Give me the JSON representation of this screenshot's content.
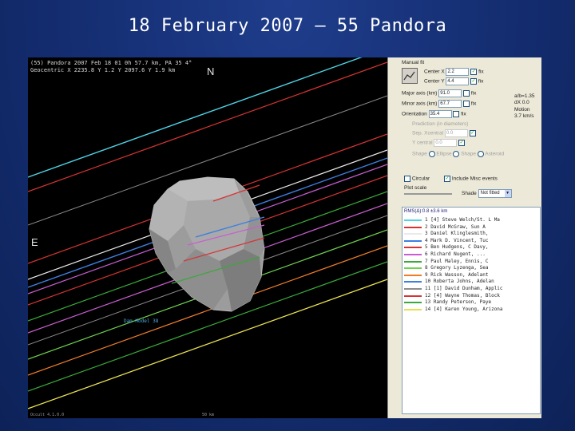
{
  "slide": {
    "title": "18 February 2007 – 55 Pandora"
  },
  "plot": {
    "header_line1": "(55) Pandora 2007 Feb 18  01 0h 57.7 km, PA 35 4°",
    "header_line2": "Geocentric X  2235.8 Y 1.2 Y 2097.6 Y 1.9 km",
    "compass_north": "N",
    "compass_east": "E",
    "model_label": "Dam Model 38",
    "status_left": "Occult 4.1.0.0",
    "status_mid": "50 km"
  },
  "panel": {
    "fit_title": "Manual fit",
    "center_x_label": "Center X",
    "center_x_value": "2.2",
    "center_y_label": "Center Y",
    "center_y_value": "4.4",
    "major_label": "Major axis (km)",
    "major_value": "91.0",
    "minor_label": "Minor axis (km)",
    "minor_value": "67.7",
    "orient_label": "Orientation",
    "orient_value": "35.4",
    "fix_label": "fix",
    "side_note1": "a/b=1.35",
    "side_note2": "dX 0.0",
    "motion_label": "Motion",
    "motion_value": "3.7 km/s",
    "predict_label": "Prediction (in diameters)",
    "pred_x_label": "Sep. Xcentral",
    "pred_x_value": "0.0",
    "pred_y_label": "Y central",
    "pred_y_value": "0.0",
    "shape_label": "Shape",
    "shape_opt1": "Ellipse",
    "shape_opt2": "Shape",
    "shape_opt3": "Asteroid",
    "circular_label": "Circular",
    "include_label": "Include Misc events",
    "plot_scale_label": "Plot scale",
    "shade_label": "Shade",
    "shade_value": "Not fitted",
    "rms_label": "RMS(Δ):0.8 ±3.6 km",
    "chords": [
      {
        "num": "1 [4]",
        "name": "Steve Welch/St. L Ma",
        "color": "#4fd3e6"
      },
      {
        "num": "2",
        "name": "David McGraw, Sun A",
        "color": "#d63434"
      },
      {
        "num": "3",
        "name": "Daniel Klinglesmith,",
        "color": "#eaeaea"
      },
      {
        "num": "4",
        "name": "Mark D. Vincent, Tuc",
        "color": "#3f7fe0"
      },
      {
        "num": "5",
        "name": "Ben Hudgens, C Davy,",
        "color": "#d63434"
      },
      {
        "num": "6",
        "name": "Richard Nugent, ...",
        "color": "#c95dd0"
      },
      {
        "num": "7",
        "name": "Paul Maley, Ennis, C",
        "color": "#3aa83a"
      },
      {
        "num": "8",
        "name": "Gregory Lyzenga, Sea",
        "color": "#6fd24f"
      },
      {
        "num": "9",
        "name": "Rick Wasson, Adelant",
        "color": "#ee7d2a"
      },
      {
        "num": "10",
        "name": "Roberta Johns, Adelan",
        "color": "#3f7fe0"
      },
      {
        "num": "11 [1]",
        "name": "David Dunham, Applic",
        "color": "#8d8d8d"
      },
      {
        "num": "12 [4]",
        "name": "Wayne Thomas, Block",
        "color": "#d63434"
      },
      {
        "num": "13",
        "name": "Randy Peterson, Paye",
        "color": "#3aa83a"
      },
      {
        "num": "14 [4]",
        "name": "Karen Young, Arizona",
        "color": "#e8e050"
      }
    ]
  },
  "colors": {
    "cyan": "#4fd3e6",
    "red": "#d63434",
    "white": "#eaeaea",
    "blue": "#3f7fe0",
    "purple": "#c95dd0",
    "green": "#3aa83a",
    "lime": "#6fd24f",
    "orange": "#ee7d2a",
    "yellow": "#e8e050"
  }
}
